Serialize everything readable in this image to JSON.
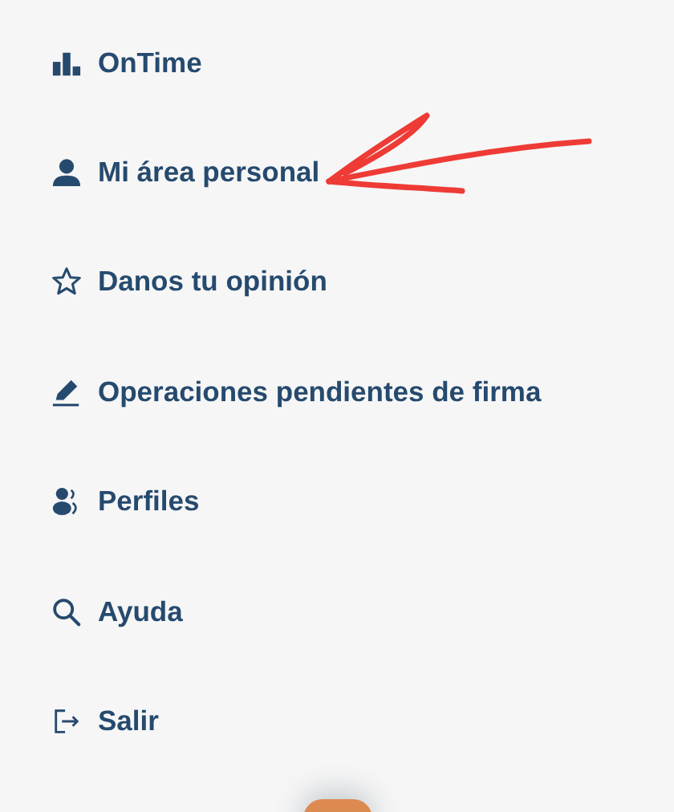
{
  "menu": {
    "items": [
      {
        "label": "OnTime",
        "kind": "chart"
      },
      {
        "label": "Mi área personal",
        "kind": "person"
      },
      {
        "label": "Danos tu opinión",
        "kind": "star"
      },
      {
        "label": "Operaciones pendientes de firma",
        "kind": "pen"
      },
      {
        "label": "Perfiles",
        "kind": "people"
      },
      {
        "label": "Ayuda",
        "kind": "search"
      },
      {
        "label": "Salir",
        "kind": "logout"
      }
    ]
  }
}
